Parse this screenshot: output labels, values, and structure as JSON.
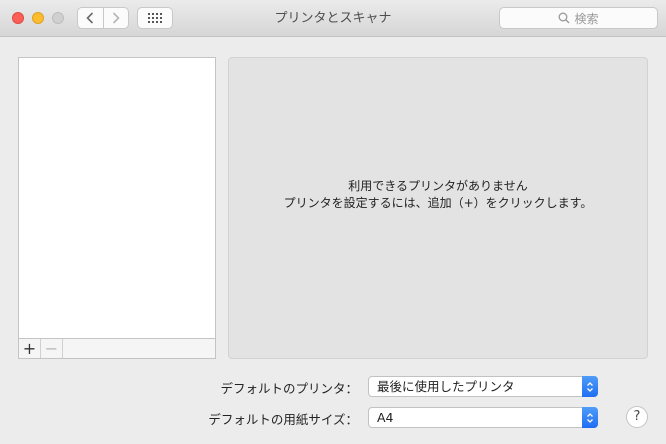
{
  "window": {
    "title": "プリンタとスキャナ",
    "traffic_colors": {
      "close": "#fc5f57",
      "minimize": "#fdbc2e",
      "maximize": "#d0d0d0"
    }
  },
  "toolbar": {
    "back_icon": "chevron-left-icon",
    "forward_icon": "chevron-right-icon",
    "grid_icon": "grid-icon",
    "search_placeholder": "検索"
  },
  "printer_list": {
    "items": [],
    "add_label": "+",
    "remove_label": "−"
  },
  "detail": {
    "message_line1": "利用できるプリンタがありません",
    "message_line2": "プリンタを設定するには、追加（+）をクリックします。"
  },
  "settings": {
    "default_printer_label": "デフォルトのプリンタ：",
    "default_printer_value": "最後に使用したプリンタ",
    "default_paper_label": "デフォルトの用紙サイズ：",
    "default_paper_value": "A4"
  },
  "help": {
    "label": "?"
  },
  "accent_color": "#1f6ef2"
}
